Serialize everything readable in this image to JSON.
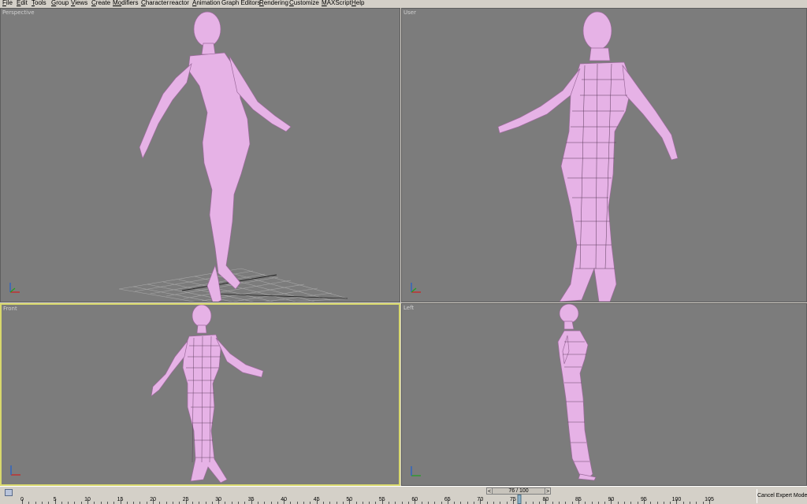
{
  "menu": [
    {
      "u": "F",
      "rest": "ile"
    },
    {
      "u": "E",
      "rest": "dit"
    },
    {
      "u": "T",
      "rest": "ools"
    },
    {
      "u": "G",
      "rest": "roup"
    },
    {
      "u": "V",
      "rest": "iews"
    },
    {
      "u": "C",
      "rest": "reate"
    },
    {
      "u": "Mo",
      "rest": "difiers",
      "alt": true
    },
    {
      "u": "C",
      "rest": "haracter"
    },
    {
      "u": "",
      "rest": "reactor"
    },
    {
      "u": "A",
      "rest": "nimation"
    },
    {
      "u": "",
      "rest": "Graph Editors"
    },
    {
      "u": "R",
      "rest": "endering"
    },
    {
      "u": "C",
      "rest": "ustomize"
    },
    {
      "u": "M",
      "rest": "AXScript"
    },
    {
      "u": "H",
      "rest": "elp"
    }
  ],
  "viewports": {
    "perspective": {
      "label": "Perspective"
    },
    "user": {
      "label": "User"
    },
    "front": {
      "label": "Front"
    },
    "left": {
      "label": "Left"
    }
  },
  "colors": {
    "mesh": "#e6b2e6",
    "mesh_dark": "#9c6a9c",
    "viewport_bg": "#7c7c7c",
    "active_border": "#d8d86c"
  },
  "timeline": {
    "slider_label": "76 / 100",
    "current_frame": 76,
    "total_frames": 100,
    "ruler_labels": [
      "0",
      "5",
      "10",
      "15",
      "20",
      "25",
      "30",
      "35",
      "40",
      "45",
      "50",
      "55",
      "60",
      "65",
      "70",
      "75",
      "80",
      "85",
      "90",
      "95",
      "100",
      "105"
    ]
  },
  "status": {
    "expert_mode_button": "Cancel Expert Mode"
  },
  "icons": {
    "axis_tripod": "axis-tripod-icon",
    "prev": "left-arrow-icon",
    "next": "right-arrow-icon"
  }
}
